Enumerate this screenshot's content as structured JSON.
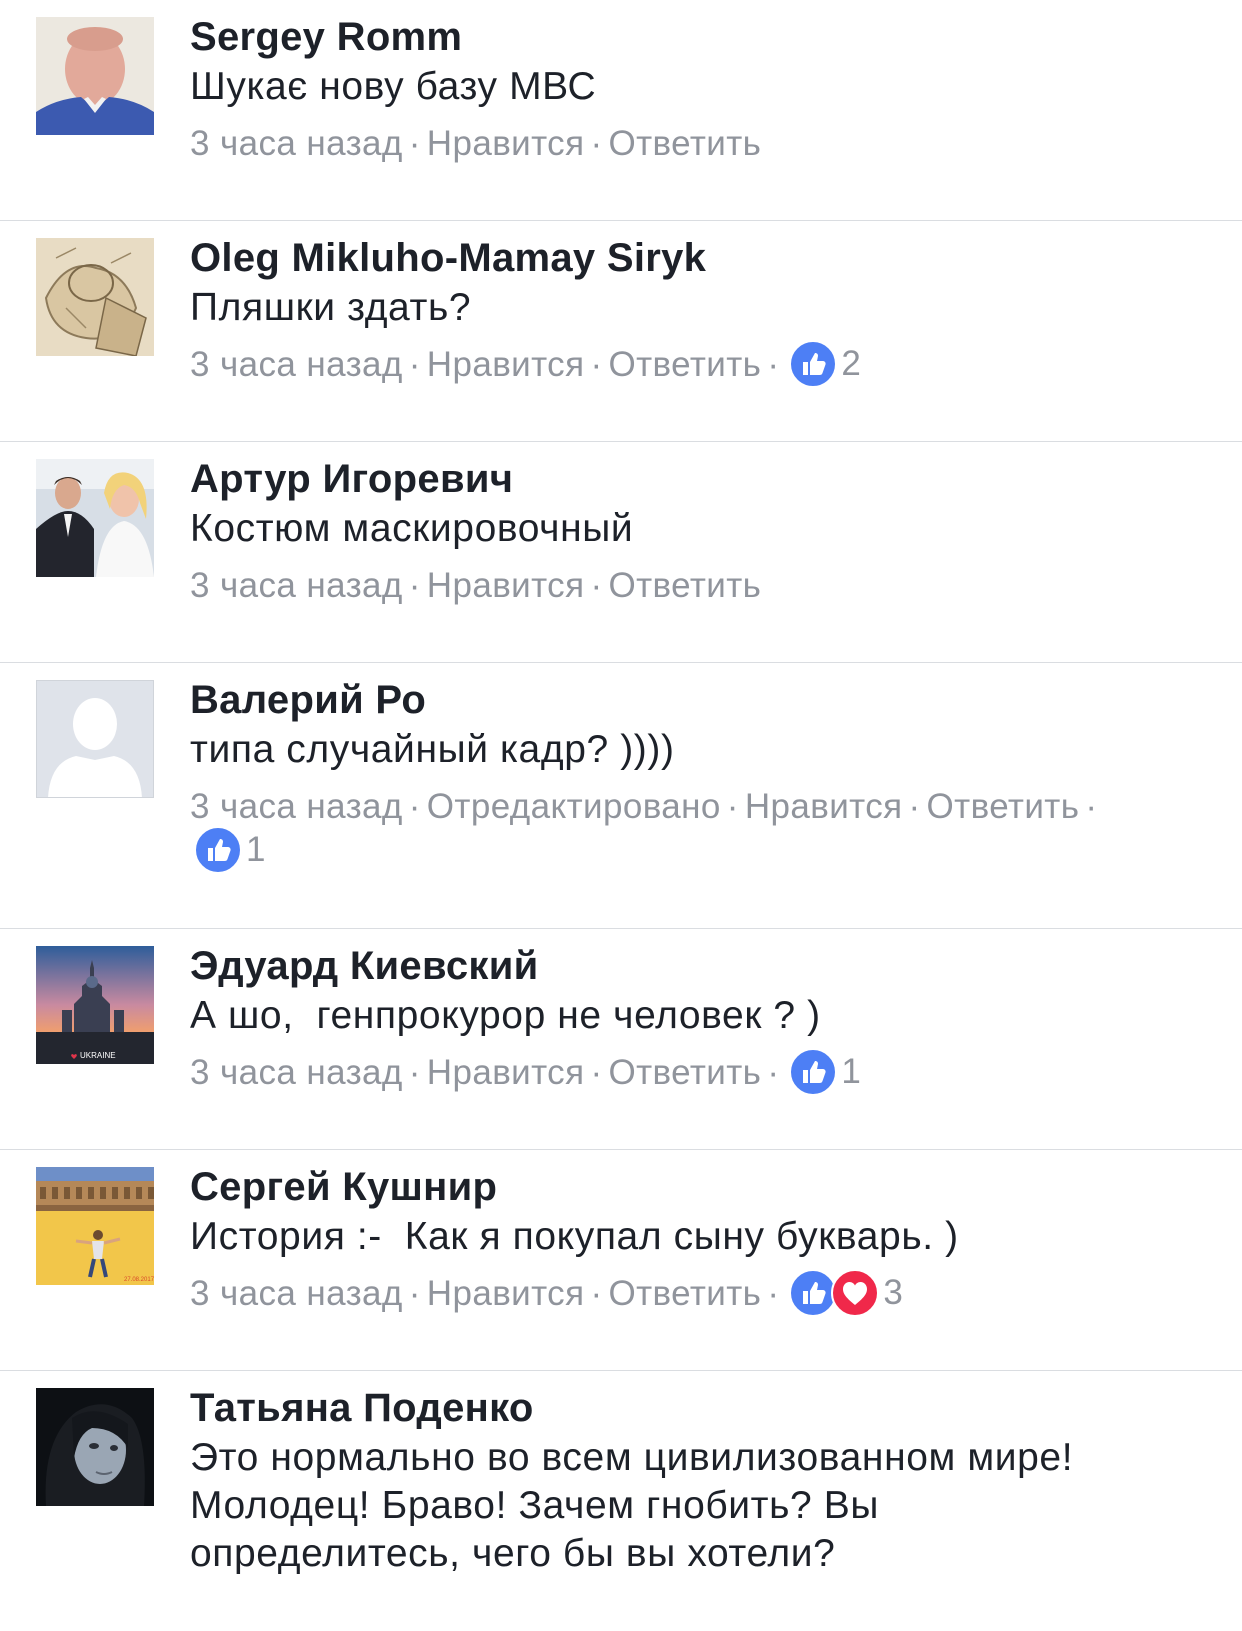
{
  "comments": [
    {
      "author": "Sergey Romm",
      "text": "Шукає нову базу МВС",
      "time": "3 часа назад",
      "like": "Нравится",
      "reply": "Ответить",
      "avatar": "person-photo-icon"
    },
    {
      "author": "Oleg Mikluho-Mamay Siryk",
      "text": "Пляшки здать?",
      "time": "3 часа назад",
      "like": "Нравится",
      "reply": "Ответить",
      "reaction_count": "2",
      "avatar": "sketch-drawing-icon"
    },
    {
      "author": "Артур Игоревич",
      "text": "Костюм маскировочный",
      "time": "3 часа назад",
      "like": "Нравится",
      "reply": "Ответить",
      "avatar": "wedding-photo-icon"
    },
    {
      "author": "Валерий Ро",
      "text": "типа случайный кадр? ))))",
      "time": "3 часа назад",
      "edited": "Отредактировано",
      "like": "Нравится",
      "reply": "Ответить",
      "reaction_count": "1",
      "avatar": "default-silhouette-icon"
    },
    {
      "author": "Эдуард Киевский",
      "text": "А шо,  генпрокурор не человек ? )",
      "time": "3 часа назад",
      "like": "Нравится",
      "reply": "Ответить",
      "reaction_count": "1",
      "avatar": "church-sunset-icon",
      "avatar_caption": "UKRAINE"
    },
    {
      "author": "Сергей Кушнир",
      "text": "История :-  Как я покупал сыну букварь. )",
      "time": "3 часа назад",
      "like": "Нравится",
      "reply": "Ответить",
      "reaction_count": "3",
      "avatar": "arena-photo-icon"
    },
    {
      "author": "Татьяна Поденко",
      "text": "Это нормально во всем цивилизованном мире! Молодец! Браво! Зачем гнобить? Вы определитесь, чего бы вы хотели?",
      "avatar": "portrait-photo-icon"
    }
  ],
  "separator": "·",
  "colors": {
    "like_blue": "#4d7ff5",
    "love_red": "#f0284a",
    "meta_gray": "#90949c",
    "divider": "#dadde1"
  }
}
